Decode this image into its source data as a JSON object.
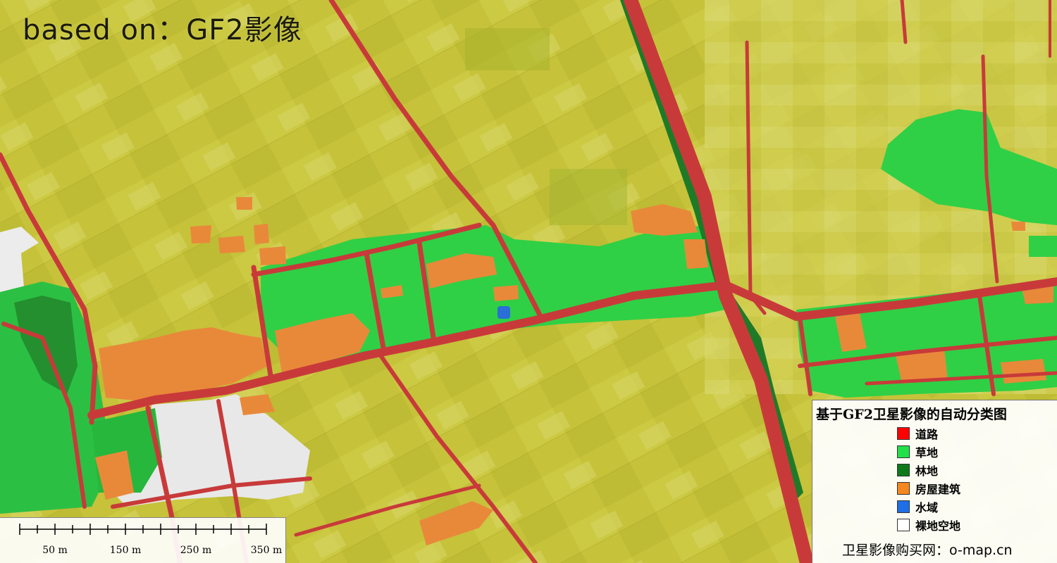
{
  "caption": "based on：GF2影像",
  "legend": {
    "title": "基于GF2卫星影像的自动分类图",
    "items": [
      {
        "label": "道路",
        "color": "#ff0000"
      },
      {
        "label": "草地",
        "color": "#22e04a"
      },
      {
        "label": "林地",
        "color": "#0c7a1a"
      },
      {
        "label": "房屋建筑",
        "color": "#f5871f"
      },
      {
        "label": "水域",
        "color": "#1e6fe6"
      },
      {
        "label": "裸地空地",
        "color": "#ffffff"
      }
    ],
    "footer": "卫星影像购买网：o-map.cn"
  },
  "scalebar": {
    "labels": [
      "50 m",
      "150 m",
      "250 m",
      "350 m"
    ]
  },
  "colors": {
    "farmland": "#c9c43a",
    "road": "#c83a3a",
    "grassland": "#2fd045",
    "forest": "#1f7a28",
    "building": "#e8893a",
    "water": "#2a6ed8",
    "bare": "#e6e6e6"
  }
}
